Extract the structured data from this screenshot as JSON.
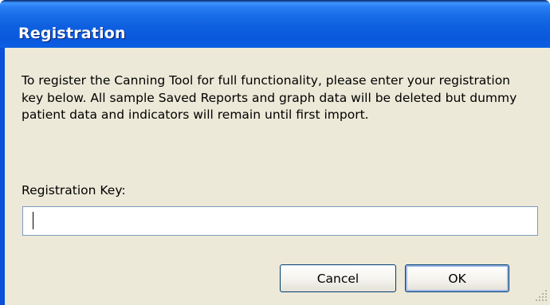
{
  "window": {
    "title": "Registration"
  },
  "message": "To register the Canning Tool for full functionality, please enter your registration key below.  All sample Saved Reports and graph data will be deleted but dummy patient data and indicators will remain until first import.",
  "registration_key": {
    "label": "Registration Key:",
    "value": "",
    "placeholder": ""
  },
  "buttons": {
    "cancel_label": "Cancel",
    "ok_label": "OK"
  },
  "colors": {
    "title_bar": "#0b5fe3",
    "client_background": "#ece9d8",
    "input_border": "#7f9db9",
    "button_border": "#003c74"
  },
  "icons": [
    "resize-grip-icon"
  ]
}
